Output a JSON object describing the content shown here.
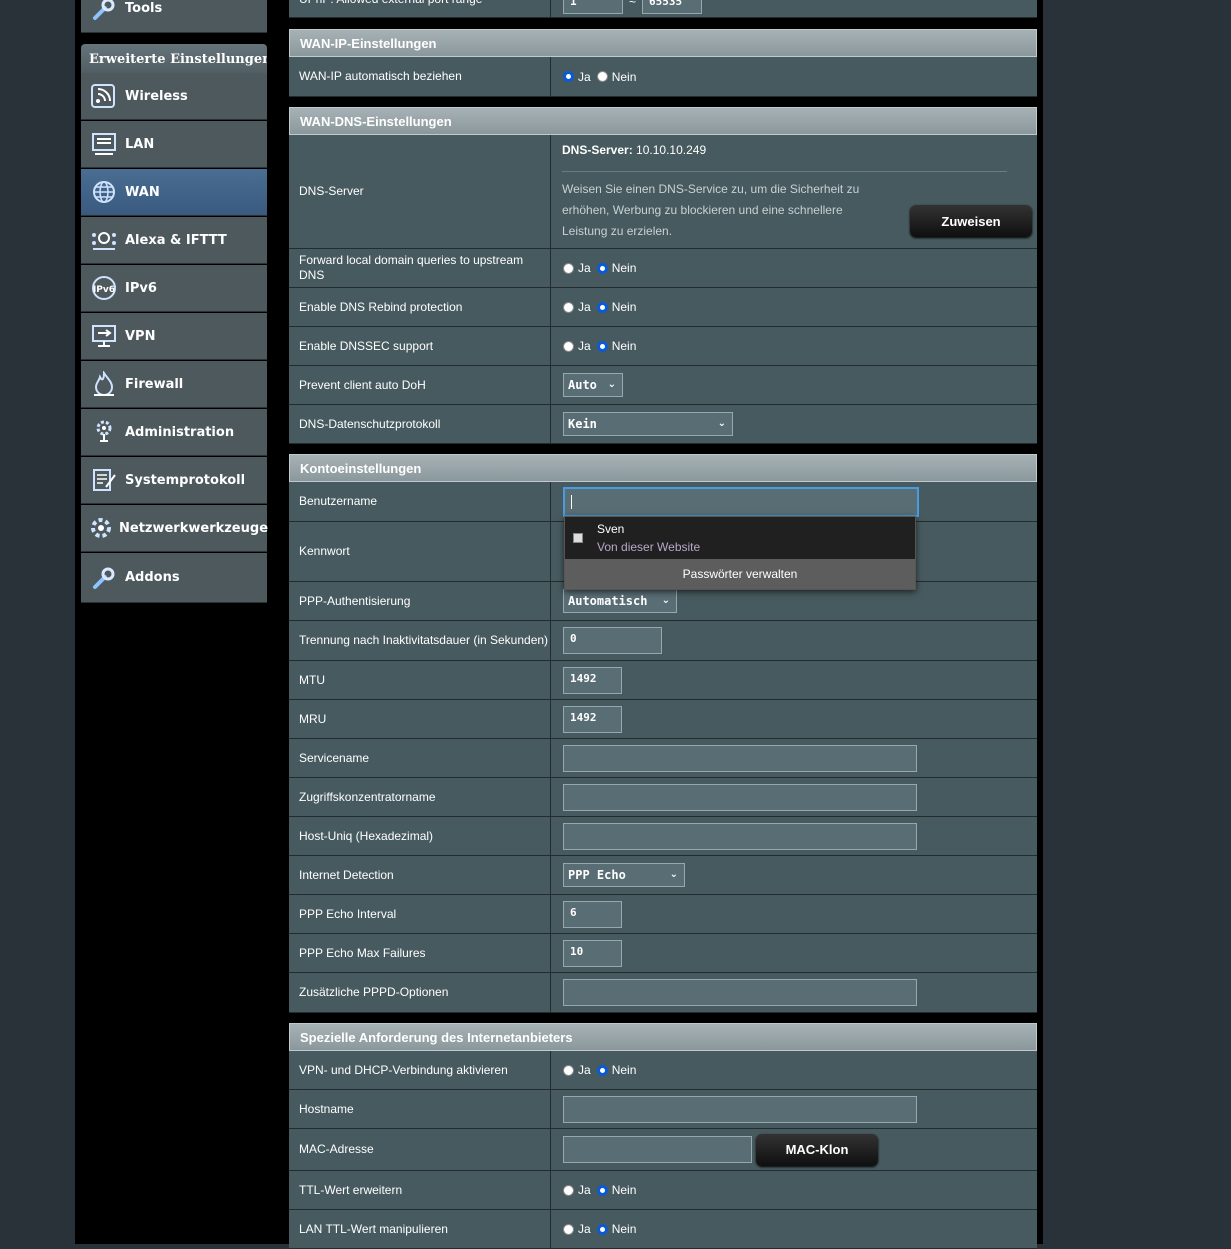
{
  "sidebar": {
    "top_item": "Tools",
    "section_title": "Erweiterte Einstellungen",
    "items": [
      {
        "label": "Wireless",
        "icon": "wireless-icon"
      },
      {
        "label": "LAN",
        "icon": "lan-icon"
      },
      {
        "label": "WAN",
        "icon": "globe-icon",
        "active": true
      },
      {
        "label": "Alexa & IFTTT",
        "icon": "alexa-icon"
      },
      {
        "label": "IPv6",
        "icon": "ipv6-icon"
      },
      {
        "label": "VPN",
        "icon": "vpn-icon"
      },
      {
        "label": "Firewall",
        "icon": "fire-icon"
      },
      {
        "label": "Administration",
        "icon": "admin-gear-icon"
      },
      {
        "label": "Systemprotokoll",
        "icon": "log-icon"
      },
      {
        "label": "Netzwerkwerkzeuge",
        "icon": "network-tools-icon"
      },
      {
        "label": "Addons",
        "icon": "wrench-icon"
      }
    ]
  },
  "top_partial": {
    "label": "UPnP: Allowed external port range",
    "from": "1",
    "to": "65535"
  },
  "wan_ip": {
    "title": "WAN-IP-Einstellungen",
    "auto_label": "WAN-IP automatisch beziehen",
    "yes": "Ja",
    "no": "Nein"
  },
  "wan_dns": {
    "title": "WAN-DNS-Einstellungen",
    "dns_label": "DNS-Server",
    "dns_prefix": "DNS-Server:",
    "dns_value": "10.10.10.249",
    "dns_note": "Weisen Sie einen DNS-Service zu, um die Sicherheit zu erhöhen, Werbung zu blockieren und eine schnellere Leistung zu erzielen.",
    "assign_button": "Zuweisen",
    "forward_label": "Forward local domain queries to upstream DNS",
    "rebind_label": "Enable DNS Rebind protection",
    "dnssec_label": "Enable DNSSEC support",
    "doh_label": "Prevent client auto DoH",
    "doh_value": "Auto",
    "privacy_label": "DNS-Datenschutzprotokoll",
    "privacy_value": "Kein",
    "yes": "Ja",
    "no": "Nein"
  },
  "account": {
    "title": "Kontoeinstellungen",
    "username_label": "Benutzername",
    "password_label": "Kennwort",
    "ppp_auth_label": "PPP-Authentisierung",
    "ppp_auth_value": "Automatisch",
    "idle_label": "Trennung nach Inaktivitatsdauer (in Sekunden)",
    "idle_value": "0",
    "mtu_label": "MTU",
    "mtu_value": "1492",
    "mru_label": "MRU",
    "mru_value": "1492",
    "service_label": "Servicename",
    "concentrator_label": "Zugriffskonzentratorname",
    "hostuniq_label": "Host-Uniq (Hexadezimal)",
    "detect_label": "Internet Detection",
    "detect_value": "PPP Echo",
    "echo_interval_label": "PPP Echo Interval",
    "echo_interval_value": "6",
    "echo_fail_label": "PPP Echo Max Failures",
    "echo_fail_value": "10",
    "pppd_label": "Zusätzliche PPPD-Optionen"
  },
  "autofill": {
    "name": "Sven",
    "source": "Von dieser Website",
    "manage": "Passwörter verwalten"
  },
  "isp": {
    "title": "Spezielle Anforderung des Internetanbieters",
    "vpn_dhcp_label": "VPN- und DHCP-Verbindung aktivieren",
    "hostname_label": "Hostname",
    "mac_label": "MAC-Adresse",
    "mac_button": "MAC-Klon",
    "ttl_label": "TTL-Wert erweitern",
    "lan_ttl_label": "LAN TTL-Wert manipulieren",
    "yes": "Ja",
    "no": "Nein"
  }
}
